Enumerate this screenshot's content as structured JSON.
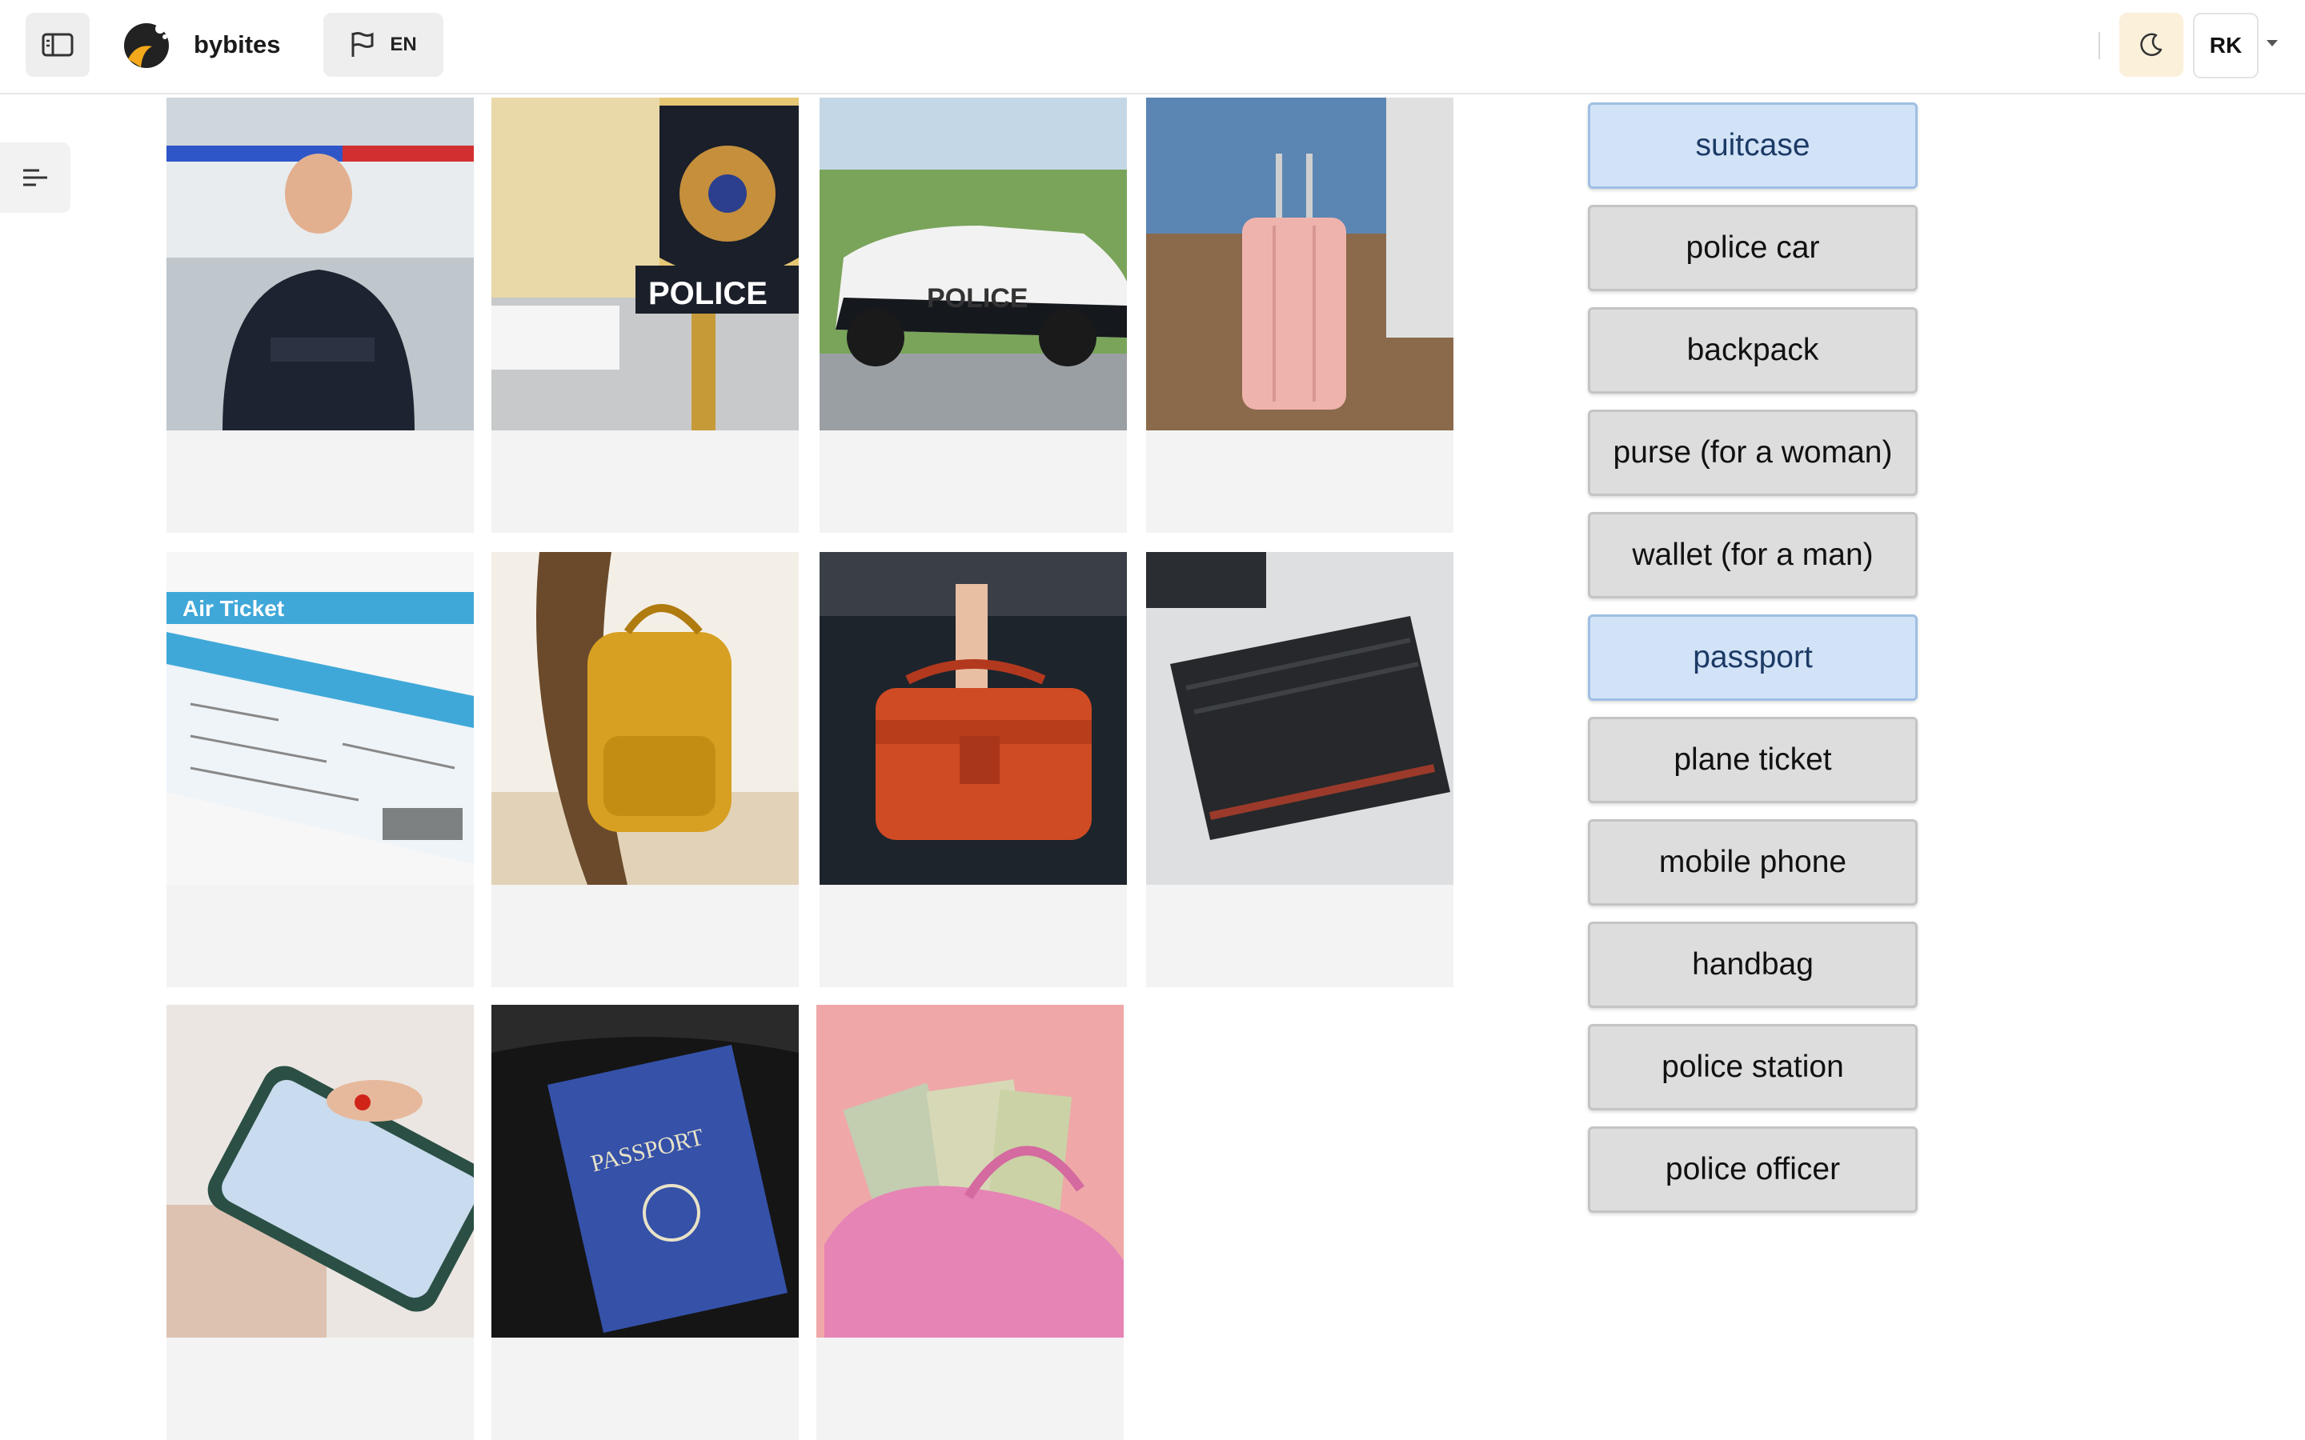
{
  "header": {
    "brand": "bybites",
    "language": "EN",
    "user_initials": "RK",
    "icons": {
      "sidebar_toggle": "sidebar-panel-icon",
      "language": "flag-icon",
      "theme": "moon-icon",
      "outline": "outline-list-icon"
    }
  },
  "images": [
    {
      "subject": "police officer"
    },
    {
      "subject": "police station"
    },
    {
      "subject": "police car",
      "sign_text": "POLICE"
    },
    {
      "subject": "suitcase"
    },
    {
      "subject": "plane ticket",
      "ticket_text": "Air Ticket"
    },
    {
      "subject": "backpack"
    },
    {
      "subject": "handbag"
    },
    {
      "subject": "wallet"
    },
    {
      "subject": "mobile phone"
    },
    {
      "subject": "passport",
      "cover_text": "PASSPORT"
    },
    {
      "subject": "purse"
    }
  ],
  "words": [
    {
      "label": "suitcase",
      "selected": true
    },
    {
      "label": "police car",
      "selected": false
    },
    {
      "label": "backpack",
      "selected": false
    },
    {
      "label": "purse (for a woman)",
      "selected": false
    },
    {
      "label": "wallet (for a man)",
      "selected": false
    },
    {
      "label": "passport",
      "selected": true
    },
    {
      "label": "plane ticket",
      "selected": false
    },
    {
      "label": "mobile phone",
      "selected": false
    },
    {
      "label": "handbag",
      "selected": false
    },
    {
      "label": "police station",
      "selected": false
    },
    {
      "label": "police officer",
      "selected": false
    }
  ],
  "colors": {
    "accent_selected_bg": "#d3e3f7",
    "accent_selected_text": "#1c3a66",
    "word_bg": "#dddddd",
    "card_bg": "#f3f3f3"
  }
}
